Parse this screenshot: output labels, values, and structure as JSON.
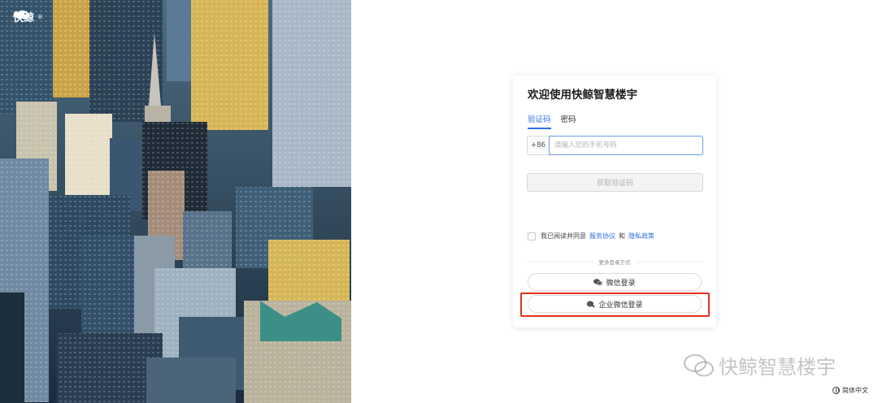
{
  "brand": {
    "name": "快鲸",
    "sup": "®"
  },
  "card": {
    "title": "欢迎使用快鲸智慧楼宇",
    "tabs": [
      {
        "label": "验证码",
        "active": true
      },
      {
        "label": "密码",
        "active": false
      }
    ],
    "country_code": "+86",
    "phone_placeholder": "请输入您的手机号码",
    "get_code_label": "获取验证码",
    "agree_text": "我已阅读并同意",
    "terms_link": "服务协议",
    "and_text": "和",
    "privacy_link": "隐私政策",
    "more_login_label": "更多登录方式",
    "wechat_login_label": "微信登录",
    "wecom_login_label": "企业微信登录"
  },
  "watermark": {
    "text": "快鲸智慧楼宇"
  },
  "language": {
    "label": "简体中文"
  },
  "colors": {
    "accent": "#2f6fe4",
    "highlight": "#e0321e"
  }
}
